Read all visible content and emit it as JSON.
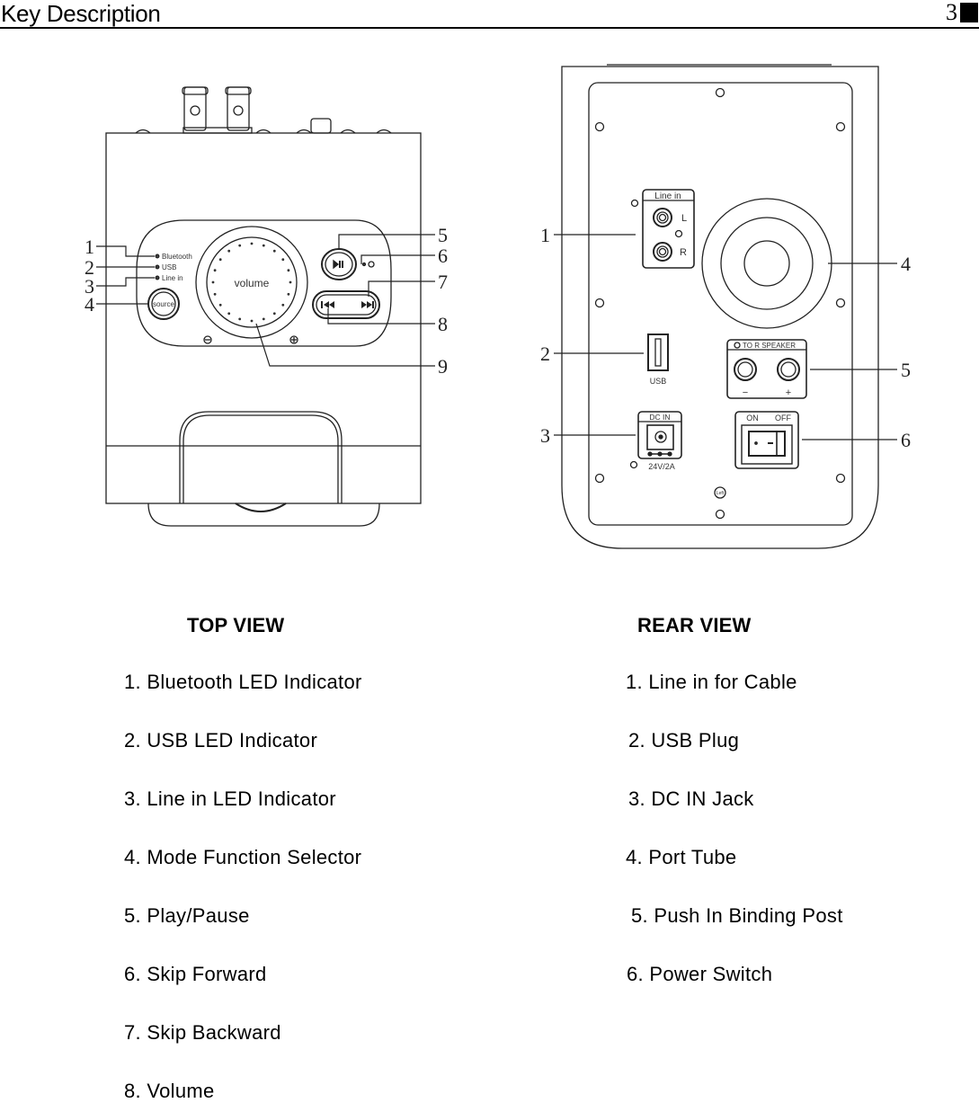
{
  "header": {
    "title": "Key Description",
    "page_number": "3"
  },
  "top_view": {
    "title": "TOP VIEW",
    "panel_labels": {
      "bluetooth": "Bluetooth",
      "usb": "USB",
      "line_in": "Line in",
      "source": "source",
      "volume": "volume"
    },
    "callouts": [
      "1",
      "2",
      "3",
      "4",
      "5",
      "6",
      "7",
      "8",
      "9"
    ],
    "items": [
      "1. Bluetooth LED Indicator",
      "2. USB LED Indicator",
      "3. Line in LED Indicator",
      "4. Mode Function Selector",
      "5. Play/Pause",
      "6. Skip Forward",
      "7. Skip Backward",
      "8. Volume"
    ]
  },
  "rear_view": {
    "title": "REAR VIEW",
    "panel_labels": {
      "line_in": "Line in",
      "left": "L",
      "right": "R",
      "usb": "USB",
      "speaker": "TO R SPEAKER",
      "minus": "−",
      "plus": "+",
      "dc_in": "DC IN",
      "dc_rating": "24V/2A",
      "on": "ON",
      "off": "OFF",
      "badge": "Left"
    },
    "callouts": [
      "1",
      "2",
      "3",
      "4",
      "5",
      "6"
    ],
    "items": [
      "1. Line in for Cable",
      "2. USB Plug",
      "3. DC IN Jack",
      "4. Port Tube",
      "5. Push In Binding Post",
      "6. Power Switch"
    ]
  }
}
